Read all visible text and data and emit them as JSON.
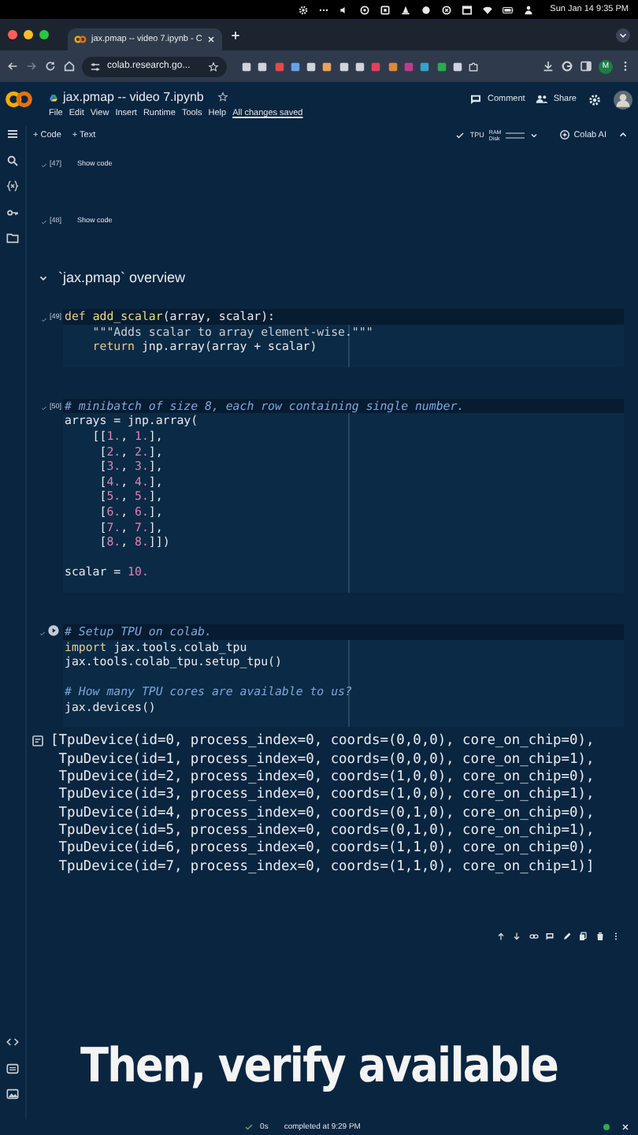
{
  "menu_bar": {
    "clock": "Sun Jan 14  9:35 PM"
  },
  "browser": {
    "tabs": [
      {
        "title": "jax.pmap -- video 7.ipynb - C",
        "selected": true
      }
    ],
    "url": "colab.research.go...",
    "profile_initial": "M"
  },
  "notebook": {
    "title": "jax.pmap -- video 7.ipynb",
    "menus": [
      "File",
      "Edit",
      "View",
      "Insert",
      "Runtime",
      "Tools",
      "Help"
    ],
    "save_status": "All changes saved",
    "actions": [
      "Comment",
      "Share"
    ]
  },
  "toolbar": {
    "add_buttons": [
      "+ Code",
      "+ Text"
    ],
    "runtime": {
      "type": "TPU",
      "ram": "RAM",
      "disk": "Disk",
      "connected": true
    },
    "ai_button": "Colab AI"
  },
  "cells": [
    {
      "kind": "collapsed",
      "exec": "[47]",
      "ran": true,
      "label": "Show code"
    },
    {
      "kind": "collapsed",
      "exec": "[48]",
      "ran": true,
      "label": "Show code"
    },
    {
      "kind": "heading",
      "text": "`jax.pmap` overview",
      "expanded": true
    },
    {
      "kind": "code",
      "exec": "[49]",
      "ran": true,
      "lines": [
        [
          {
            "kind": "keyword",
            "text": "def "
          },
          {
            "kind": "function",
            "text": "add_scalar"
          },
          {
            "kind": "plain",
            "text": "(array, scalar):"
          }
        ],
        [
          {
            "kind": "string",
            "text": "    \"\"\"Adds scalar to array element-wise.\"\"\""
          }
        ],
        [
          {
            "kind": "keyword",
            "text": "    return"
          },
          {
            "kind": "plain",
            "text": " jnp.array(array + scalar)"
          }
        ]
      ]
    },
    {
      "kind": "code",
      "exec": "[50]",
      "ran": true,
      "lines": [
        [
          {
            "kind": "comment",
            "text": "# minibatch of size 8, each row containing single number."
          }
        ],
        [
          {
            "kind": "plain",
            "text": "arrays = jnp.array("
          }
        ],
        [
          {
            "kind": "plain",
            "text": "    [["
          },
          {
            "kind": "number",
            "text": "1."
          },
          {
            "kind": "plain",
            "text": ", "
          },
          {
            "kind": "number",
            "text": "1."
          },
          {
            "kind": "plain",
            "text": "],"
          }
        ],
        [
          {
            "kind": "plain",
            "text": "     ["
          },
          {
            "kind": "number",
            "text": "2."
          },
          {
            "kind": "plain",
            "text": ", "
          },
          {
            "kind": "number",
            "text": "2."
          },
          {
            "kind": "plain",
            "text": "],"
          }
        ],
        [
          {
            "kind": "plain",
            "text": "     ["
          },
          {
            "kind": "number",
            "text": "3."
          },
          {
            "kind": "plain",
            "text": ", "
          },
          {
            "kind": "number",
            "text": "3."
          },
          {
            "kind": "plain",
            "text": "],"
          }
        ],
        [
          {
            "kind": "plain",
            "text": "     ["
          },
          {
            "kind": "number",
            "text": "4."
          },
          {
            "kind": "plain",
            "text": ", "
          },
          {
            "kind": "number",
            "text": "4."
          },
          {
            "kind": "plain",
            "text": "],"
          }
        ],
        [
          {
            "kind": "plain",
            "text": "     ["
          },
          {
            "kind": "number",
            "text": "5."
          },
          {
            "kind": "plain",
            "text": ", "
          },
          {
            "kind": "number",
            "text": "5."
          },
          {
            "kind": "plain",
            "text": "],"
          }
        ],
        [
          {
            "kind": "plain",
            "text": "     ["
          },
          {
            "kind": "number",
            "text": "6."
          },
          {
            "kind": "plain",
            "text": ", "
          },
          {
            "kind": "number",
            "text": "6."
          },
          {
            "kind": "plain",
            "text": "],"
          }
        ],
        [
          {
            "kind": "plain",
            "text": "     ["
          },
          {
            "kind": "number",
            "text": "7."
          },
          {
            "kind": "plain",
            "text": ", "
          },
          {
            "kind": "number",
            "text": "7."
          },
          {
            "kind": "plain",
            "text": "],"
          }
        ],
        [
          {
            "kind": "plain",
            "text": "     ["
          },
          {
            "kind": "number",
            "text": "8."
          },
          {
            "kind": "plain",
            "text": ", "
          },
          {
            "kind": "number",
            "text": "8."
          },
          {
            "kind": "plain",
            "text": "]])"
          }
        ],
        [
          {
            "kind": "gap"
          },
          {
            "kind": "plain",
            "text": "scalar = "
          },
          {
            "kind": "number",
            "text": "10."
          }
        ]
      ]
    },
    {
      "kind": "code",
      "ran": true,
      "focused": true,
      "lines": [
        [
          {
            "kind": "comment",
            "text": "# Setup TPU on colab."
          }
        ],
        [
          {
            "kind": "keyword",
            "text": "import"
          },
          {
            "kind": "plain",
            "text": " jax.tools.colab_tpu"
          }
        ],
        [
          {
            "kind": "plain",
            "text": "jax.tools.colab_tpu.setup_tpu()"
          }
        ],
        [
          {
            "kind": "gap"
          },
          {
            "kind": "comment",
            "text": "# How many TPU cores are available to us?"
          }
        ],
        [
          {
            "kind": "plain",
            "text": "jax.devices()"
          }
        ]
      ],
      "output": [
        "[TpuDevice(id=0, process_index=0, coords=(0,0,0), core_on_chip=0),",
        " TpuDevice(id=1, process_index=0, coords=(0,0,0), core_on_chip=1),",
        " TpuDevice(id=2, process_index=0, coords=(1,0,0), core_on_chip=0),",
        " TpuDevice(id=3, process_index=0, coords=(1,0,0), core_on_chip=1),",
        " TpuDevice(id=4, process_index=0, coords=(0,1,0), core_on_chip=0),",
        " TpuDevice(id=5, process_index=0, coords=(0,1,0), core_on_chip=1),",
        " TpuDevice(id=6, process_index=0, coords=(1,1,0), core_on_chip=0),",
        " TpuDevice(id=7, process_index=0, coords=(1,1,0), core_on_chip=1)]"
      ]
    }
  ],
  "caption": "Then, verify available",
  "status_bar": {
    "duration": "0s",
    "message": "completed at 9:29 PM",
    "connected": true
  }
}
